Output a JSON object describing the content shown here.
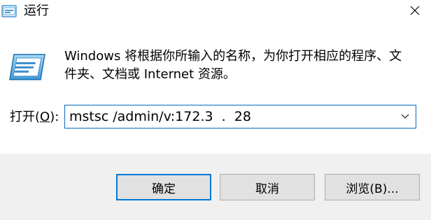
{
  "window": {
    "title": "运行",
    "icon": "run-dialog-icon",
    "close_icon": "close-icon"
  },
  "content": {
    "description": "Windows 将根据你所输入的名称，为你打开相应的程序、文件夹、文档或 Internet 资源。",
    "run_icon": "run-program-icon"
  },
  "open_field": {
    "label_prefix": "打开(",
    "label_access_key": "O",
    "label_suffix": "):",
    "value": "mstsc /admin/v:172.3  .  28",
    "dropdown_icon": "chevron-down-icon"
  },
  "buttons": {
    "ok_label": "确定",
    "cancel_label": "取消",
    "browse_label": "浏览(B)..."
  },
  "colors": {
    "accent": "#0078d7",
    "input_border": "#0a66c8",
    "footer_bg": "#f0f0f0",
    "button_bg": "#e1e1e1"
  }
}
